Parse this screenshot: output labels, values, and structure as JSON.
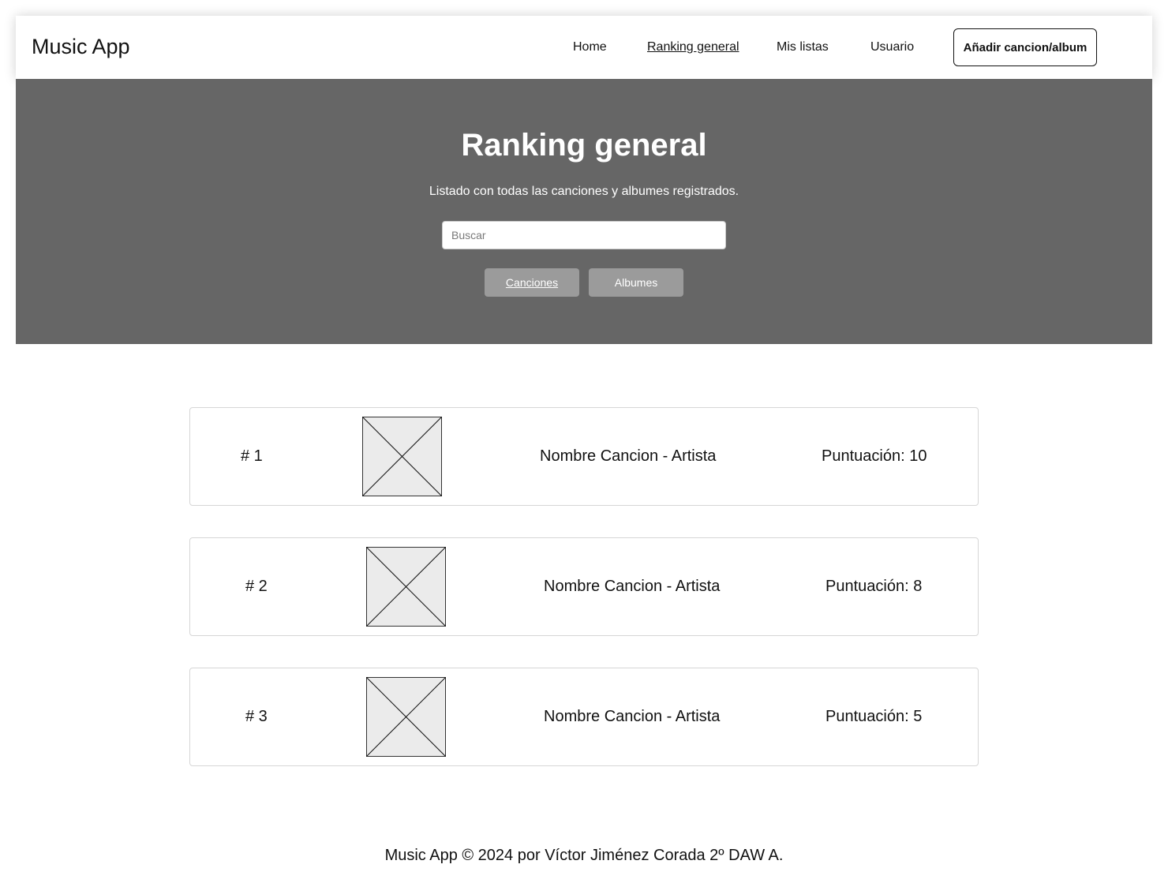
{
  "navbar": {
    "brand": "Music App",
    "links": [
      "Home",
      "Ranking general",
      "Mis listas",
      "Usuario"
    ],
    "active_link": "Ranking general",
    "cta_label": "Añadir cancion/album"
  },
  "hero": {
    "title": "Ranking general",
    "subtitle": "Listado con todas las canciones y albumes registrados.",
    "search_placeholder": "Buscar",
    "tabs": [
      "Canciones",
      "Albumes"
    ],
    "active_tab": "Canciones"
  },
  "ranking": [
    {
      "rank": "# 1",
      "thumbnail": "image-placeholder-icon",
      "title": "Nombre Cancion - Artista",
      "score": "Puntuación: 10"
    },
    {
      "rank": "# 2",
      "thumbnail": "image-placeholder-icon",
      "title": "Nombre Cancion - Artista",
      "score": "Puntuación: 8"
    },
    {
      "rank": "# 3",
      "thumbnail": "image-placeholder-icon",
      "title": "Nombre Cancion - Artista",
      "score": "Puntuación: 5"
    }
  ],
  "footer": {
    "text": "Music App © 2024 por Víctor Jiménez Corada 2º DAW A."
  },
  "colors": {
    "hero_background": "#666666",
    "tab_background": "#9b9b9b",
    "placeholder_fill": "#ebebeb"
  }
}
